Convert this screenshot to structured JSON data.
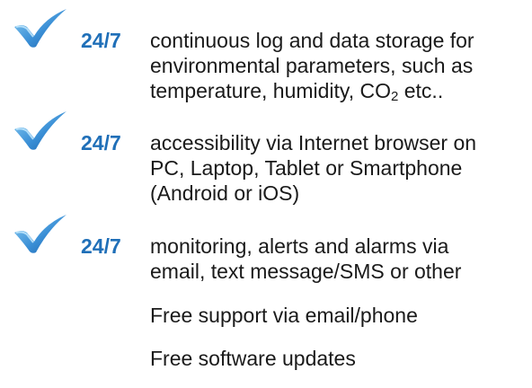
{
  "features": [
    {
      "tag": "24/7",
      "lines": [
        "continuous log and data storage for",
        "environmental parameters, such as"
      ],
      "line3_prefix": "temperature, humidity, CO",
      "line3_sub": "2",
      "line3_suffix": " etc.."
    },
    {
      "tag": "24/7",
      "lines": [
        "accessibility via Internet browser on",
        "PC, Laptop, Tablet or Smartphone",
        "(Android or iOS)"
      ]
    },
    {
      "tag": "24/7",
      "lines": [
        "monitoring, alerts and alarms via",
        "email, text message/SMS or other"
      ]
    }
  ],
  "extras": [
    "Free support via email/phone",
    "Free software updates"
  ],
  "colors": {
    "accent": "#1f6fb8",
    "check_light": "#7fc4ee",
    "check_dark": "#1b5fa8",
    "text": "#1a1a1a"
  },
  "icons": {
    "bullet": "checkmark-icon"
  }
}
